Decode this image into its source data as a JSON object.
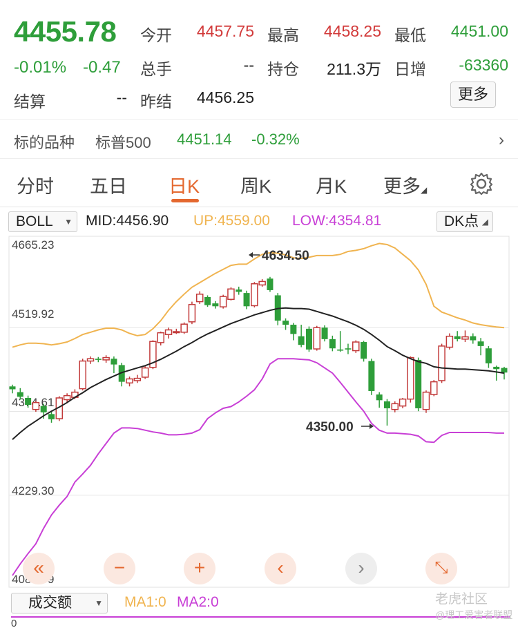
{
  "quote": {
    "price": "4455.78",
    "change_pct": "-0.01%",
    "change": "-0.47",
    "open_label": "今开",
    "open": "4457.75",
    "high_label": "最高",
    "high": "4458.25",
    "low_label": "最低",
    "low": "4451.00",
    "volume_label": "总手",
    "volume": "--",
    "oi_label": "持仓",
    "oi": "211.3万",
    "daily_inc_label": "日增",
    "daily_inc": "-63360",
    "settle_label": "结算",
    "settle": "--",
    "prev_settle_label": "昨结",
    "prev_settle": "4456.25",
    "more_label": "更多"
  },
  "underlying": {
    "label": "标的品种",
    "name": "标普500",
    "price": "4451.14",
    "change_pct": "-0.32%"
  },
  "tabs": [
    {
      "label": "分时"
    },
    {
      "label": "五日"
    },
    {
      "label": "日K"
    },
    {
      "label": "周K"
    },
    {
      "label": "月K"
    },
    {
      "label": "更多"
    }
  ],
  "indicator": {
    "select": "BOLL",
    "mid": "MID:4456.90",
    "up": "UP:4559.00",
    "low": "LOW:4354.81",
    "dk_label": "DK点"
  },
  "colors": {
    "up_candle": "#c23a3a",
    "down_candle": "#2e9e3a",
    "mid_line": "#222222",
    "up_line": "#f0b450",
    "low_line": "#c83fd6",
    "accent": "#e4682f"
  },
  "chart_data": {
    "type": "candlestick",
    "y_ticks": [
      "4665.23",
      "4519.92",
      "4374.61",
      "4229.30",
      "4083.99"
    ],
    "ylim": [
      4083.99,
      4665.23
    ],
    "annotations": [
      {
        "text": "4634.50",
        "kind": "max"
      },
      {
        "text": "4350.00",
        "kind": "min"
      }
    ],
    "candles": [
      [
        4418,
        4413,
        4421,
        4406
      ],
      [
        4408,
        4400,
        4415,
        4395
      ],
      [
        4398,
        4386,
        4402,
        4381
      ],
      [
        4378,
        4390,
        4393,
        4374
      ],
      [
        4384,
        4373,
        4388,
        4362
      ],
      [
        4370,
        4361,
        4376,
        4355
      ],
      [
        4362,
        4398,
        4401,
        4358
      ],
      [
        4395,
        4402,
        4406,
        4390
      ],
      [
        4399,
        4408,
        4413,
        4396
      ],
      [
        4414,
        4462,
        4466,
        4411
      ],
      [
        4462,
        4466,
        4470,
        4457
      ],
      [
        4466,
        4464,
        4469,
        4460
      ],
      [
        4464,
        4468,
        4472,
        4459
      ],
      [
        4466,
        4456,
        4470,
        4441
      ],
      [
        4455,
        4426,
        4459,
        4418
      ],
      [
        4424,
        4431,
        4435,
        4418
      ],
      [
        4428,
        4432,
        4438,
        4424
      ],
      [
        4434,
        4450,
        4453,
        4431
      ],
      [
        4451,
        4496,
        4498,
        4448
      ],
      [
        4494,
        4511,
        4513,
        4489
      ],
      [
        4508,
        4516,
        4520,
        4501
      ],
      [
        4513,
        4513,
        4518,
        4509
      ],
      [
        4512,
        4526,
        4529,
        4509
      ],
      [
        4530,
        4560,
        4565,
        4526
      ],
      [
        4565,
        4578,
        4583,
        4561
      ],
      [
        4573,
        4559,
        4576,
        4556
      ],
      [
        4562,
        4557,
        4566,
        4553
      ],
      [
        4556,
        4574,
        4577,
        4553
      ],
      [
        4569,
        4587,
        4590,
        4567
      ],
      [
        4586,
        4582,
        4591,
        4577
      ],
      [
        4580,
        4557,
        4584,
        4552
      ],
      [
        4558,
        4596,
        4599,
        4555
      ],
      [
        4594,
        4600,
        4604,
        4591
      ],
      [
        4605,
        4585,
        4608,
        4582
      ],
      [
        4576,
        4532,
        4580,
        4524
      ],
      [
        4532,
        4525,
        4536,
        4516
      ],
      [
        4525,
        4509,
        4528,
        4498
      ],
      [
        4505,
        4490,
        4525,
        4486
      ],
      [
        4518,
        4482,
        4522,
        4478
      ],
      [
        4483,
        4520,
        4523,
        4480
      ],
      [
        4520,
        4500,
        4524,
        4496
      ],
      [
        4500,
        4484,
        4506,
        4479
      ],
      [
        4482,
        4480,
        4514,
        4478
      ],
      [
        4484,
        4482,
        4492,
        4474
      ],
      [
        4480,
        4495,
        4498,
        4476
      ],
      [
        4495,
        4466,
        4497,
        4461
      ],
      [
        4462,
        4410,
        4466,
        4403
      ],
      [
        4404,
        4394,
        4408,
        4381
      ],
      [
        4392,
        4380,
        4396,
        4350
      ],
      [
        4378,
        4388,
        4392,
        4373
      ],
      [
        4384,
        4396,
        4398,
        4380
      ],
      [
        4396,
        4468,
        4470,
        4390
      ],
      [
        4464,
        4380,
        4468,
        4375
      ],
      [
        4378,
        4408,
        4411,
        4372
      ],
      [
        4404,
        4426,
        4429,
        4401
      ],
      [
        4428,
        4488,
        4492,
        4424
      ],
      [
        4486,
        4505,
        4510,
        4482
      ],
      [
        4505,
        4500,
        4514,
        4496
      ],
      [
        4500,
        4504,
        4515,
        4495
      ],
      [
        4505,
        4498,
        4510,
        4492
      ],
      [
        4496,
        4488,
        4502,
        4472
      ],
      [
        4484,
        4458,
        4488,
        4450
      ],
      [
        4452,
        4448,
        4454,
        4428
      ],
      [
        4450,
        4442,
        4452,
        4430
      ]
    ],
    "mid_line": [
      4326,
      4338,
      4349,
      4358,
      4367,
      4375,
      4382,
      4390,
      4399,
      4407,
      4416,
      4423,
      4430,
      4436,
      4442,
      4446,
      4450,
      4454,
      4459,
      4465,
      4472,
      4479,
      4487,
      4494,
      4502,
      4509,
      4515,
      4521,
      4527,
      4532,
      4537,
      4542,
      4546,
      4550,
      4553,
      4554,
      4553,
      4553,
      4552,
      4548,
      4544,
      4540,
      4535,
      4530,
      4524,
      4517,
      4508,
      4498,
      4487,
      4480,
      4472,
      4466,
      4461,
      4458,
      4452,
      4450,
      4449,
      4448,
      4448,
      4447,
      4446,
      4445,
      4443,
      4441
    ],
    "up_line": [
      4486,
      4490,
      4493,
      4493,
      4492,
      4490,
      4492,
      4495,
      4501,
      4508,
      4512,
      4516,
      4519,
      4519,
      4516,
      4510,
      4506,
      4508,
      4518,
      4532,
      4550,
      4565,
      4578,
      4590,
      4598,
      4606,
      4614,
      4621,
      4628,
      4630,
      4630,
      4639,
      4647,
      4650,
      4649,
      4646,
      4641,
      4640,
      4642,
      4645,
      4645,
      4645,
      4647,
      4652,
      4654,
      4657,
      4662,
      4666,
      4664,
      4658,
      4647,
      4636,
      4620,
      4595,
      4557,
      4547,
      4542,
      4537,
      4533,
      4528,
      4525,
      4523,
      4521,
      4520
    ],
    "low_line": [
      4090,
      4110,
      4128,
      4145,
      4172,
      4195,
      4212,
      4227,
      4252,
      4266,
      4281,
      4301,
      4319,
      4337,
      4346,
      4346,
      4345,
      4342,
      4339,
      4337,
      4334,
      4334,
      4335,
      4337,
      4343,
      4362,
      4372,
      4380,
      4383,
      4391,
      4401,
      4412,
      4431,
      4457,
      4466,
      4466,
      4466,
      4465,
      4464,
      4459,
      4450,
      4441,
      4425,
      4408,
      4391,
      4375,
      4354,
      4342,
      4337,
      4337,
      4336,
      4335,
      4332,
      4322,
      4321,
      4333,
      4338,
      4338,
      4338,
      4338,
      4338,
      4338,
      4337,
      4337
    ]
  },
  "controls": [
    {
      "icon": "double-chevron-left-icon",
      "glyph": "«"
    },
    {
      "icon": "minus-icon",
      "glyph": "−"
    },
    {
      "icon": "plus-icon",
      "glyph": "+"
    },
    {
      "icon": "chevron-left-icon",
      "glyph": "‹"
    },
    {
      "icon": "chevron-right-icon",
      "glyph": "›"
    },
    {
      "icon": "expand-icon",
      "glyph": "⤡"
    }
  ],
  "volume": {
    "select": "成交额",
    "ma1": "MA1:0",
    "ma2": "MA2:0",
    "axis_zero": "0"
  },
  "watermark": {
    "line1": "老虎社区",
    "line2": "@理工爱害者联盟"
  }
}
